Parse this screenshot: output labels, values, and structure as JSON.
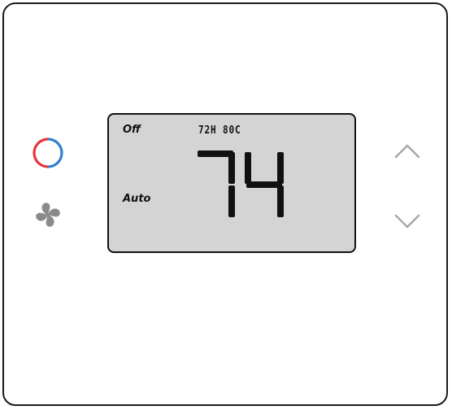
{
  "display": {
    "system_mode": "Off",
    "fan_mode": "Auto",
    "time": "72H 80C",
    "temperature": "74"
  },
  "icons": {
    "mode": "heat-cool-ring-icon",
    "fan": "fan-icon",
    "up": "chevron-up-icon",
    "down": "chevron-down-icon"
  },
  "colors": {
    "heat": "#e8343c",
    "cool": "#2f7fd0",
    "lcd_background": "#d4d4d4",
    "segment": "#111111",
    "fan_icon": "#8a8a8a",
    "arrow": "#a9a9a9"
  }
}
